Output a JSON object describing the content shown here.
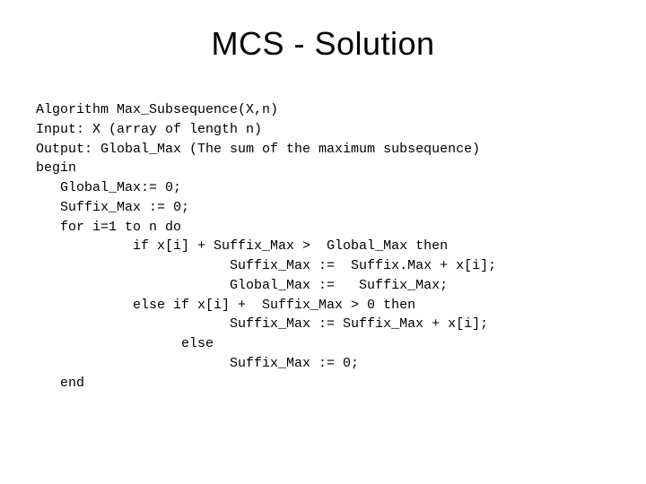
{
  "title": "MCS - Solution",
  "code": {
    "l01": "Algorithm Max_Subsequence(X,n)",
    "l02": "Input: X (array of length n)",
    "l03": "Output: Global_Max (The sum of the maximum subsequence)",
    "l04": "begin",
    "l05": "   Global_Max:= 0;",
    "l06": "   Suffix_Max := 0;",
    "l07": "   for i=1 to n do",
    "l08": "            if x[i] + Suffix_Max >  Global_Max then",
    "l09": "                        Suffix_Max :=  Suffix.Max + x[i];",
    "l10": "                        Global_Max :=   Suffix_Max;",
    "l11": "            else if x[i] +  Suffix_Max > 0 then",
    "l12": "                        Suffix_Max := Suffix_Max + x[i];",
    "l13": "                  else",
    "l14": "                        Suffix_Max := 0;",
    "l15": "   end"
  }
}
